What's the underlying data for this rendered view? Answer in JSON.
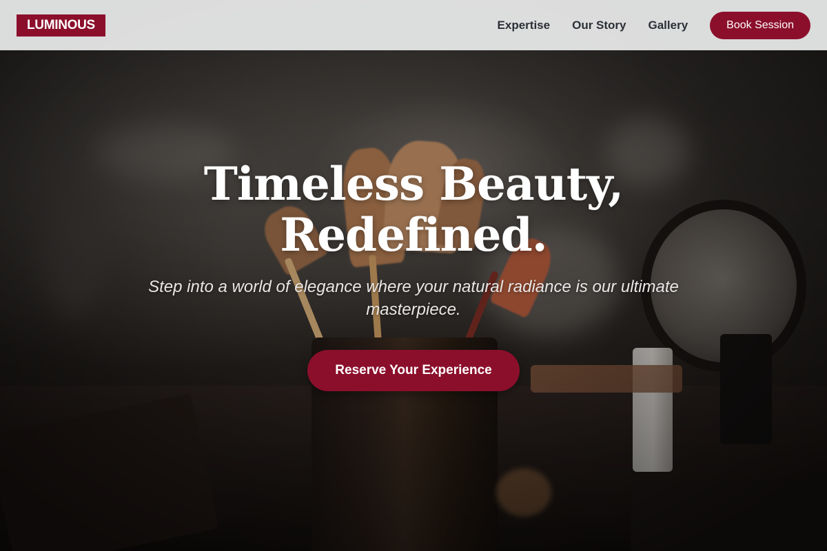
{
  "brand": {
    "logo_text": "LUMINOUS",
    "accent_color": "#8b0f2b"
  },
  "nav": {
    "links": [
      {
        "label": "Expertise"
      },
      {
        "label": "Our Story"
      },
      {
        "label": "Gallery"
      }
    ],
    "cta_label": "Book Session"
  },
  "hero": {
    "headline_line1": "Timeless Beauty,",
    "headline_line2": "Redefined.",
    "subtext": "Step into a world of elegance where your natural radiance is our ultimate masterpiece.",
    "cta_label": "Reserve Your Experience",
    "background_image": "makeup-brushes-photo"
  }
}
